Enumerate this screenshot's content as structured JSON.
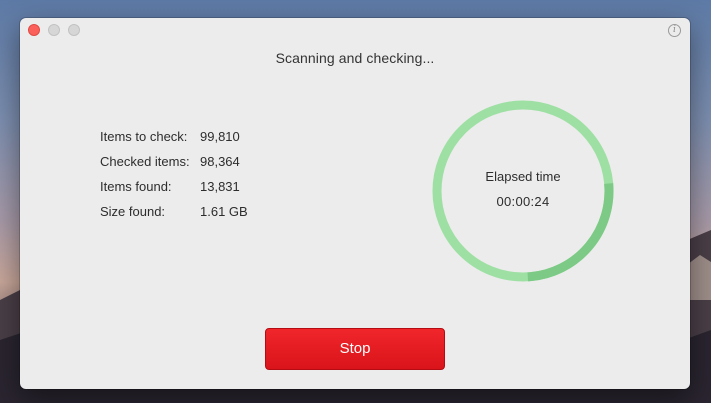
{
  "window": {
    "title": "Scanning and checking...",
    "info_icon": "info-icon",
    "info_glyph": "i"
  },
  "stats": [
    {
      "label": "Items to check:",
      "value": "99,810"
    },
    {
      "label": "Checked items:",
      "value": "98,364"
    },
    {
      "label": "Items found:",
      "value": "13,831"
    },
    {
      "label": "Size found:",
      "value": "1.61 GB"
    }
  ],
  "timer": {
    "label": "Elapsed time",
    "value": "00:00:24",
    "progress": 0.255
  },
  "actions": {
    "stop_label": "Stop"
  },
  "colors": {
    "ring_track": "#9ee0a4",
    "ring_progress": "#7cca85",
    "stop_button": "#e31a1f",
    "close_dot": "#fc605b"
  }
}
